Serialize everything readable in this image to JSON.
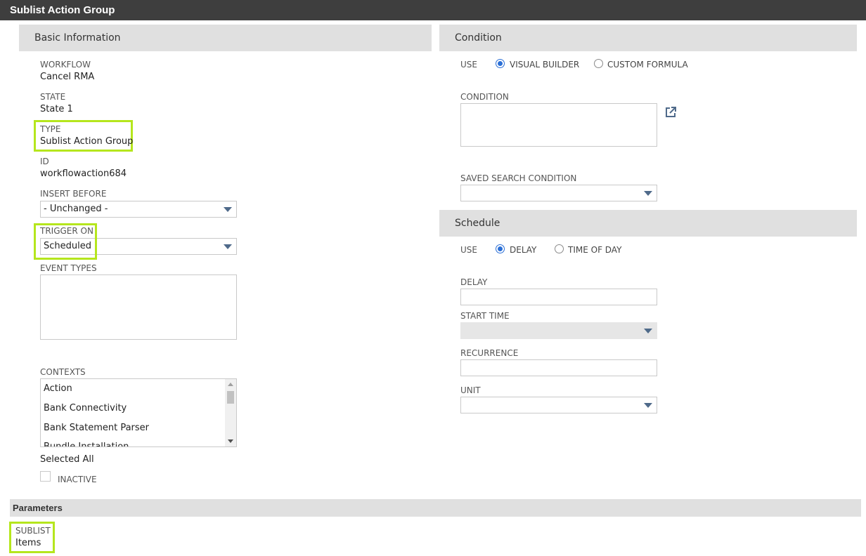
{
  "title": "Sublist Action Group",
  "basic": {
    "header": "Basic Information",
    "workflow_label": "WORKFLOW",
    "workflow_value": "Cancel RMA",
    "state_label": "STATE",
    "state_value": "State 1",
    "type_label": "TYPE",
    "type_value": "Sublist Action Group",
    "id_label": "ID",
    "id_value": "workflowaction684",
    "insert_before_label": "INSERT BEFORE",
    "insert_before_value": "- Unchanged -",
    "trigger_on_label": "TRIGGER ON",
    "trigger_on_value": "Scheduled",
    "event_types_label": "EVENT TYPES",
    "contexts_label": "CONTEXTS",
    "contexts": [
      "Action",
      "Bank Connectivity",
      "Bank Statement Parser",
      "Bundle Installation"
    ],
    "selected_all": "Selected All",
    "inactive_label": "INACTIVE"
  },
  "condition": {
    "header": "Condition",
    "use_label": "USE",
    "options": [
      "VISUAL BUILDER",
      "CUSTOM FORMULA"
    ],
    "selected": "VISUAL BUILDER",
    "condition_label": "CONDITION",
    "saved_search_label": "SAVED SEARCH CONDITION",
    "saved_search_value": ""
  },
  "schedule": {
    "header": "Schedule",
    "use_label": "USE",
    "options": [
      "DELAY",
      "TIME OF DAY"
    ],
    "selected": "DELAY",
    "delay_label": "DELAY",
    "delay_value": "",
    "start_time_label": "START TIME",
    "start_time_value": "",
    "recurrence_label": "RECURRENCE",
    "recurrence_value": "",
    "unit_label": "UNIT",
    "unit_value": ""
  },
  "parameters": {
    "header": "Parameters",
    "sublist_label": "SUBLIST",
    "sublist_value": "Items"
  },
  "colors": {
    "highlight": "#b5e61d",
    "titlebar": "#3e3e3e",
    "section": "#e0e0e0",
    "radio": "#2b6fd6"
  }
}
